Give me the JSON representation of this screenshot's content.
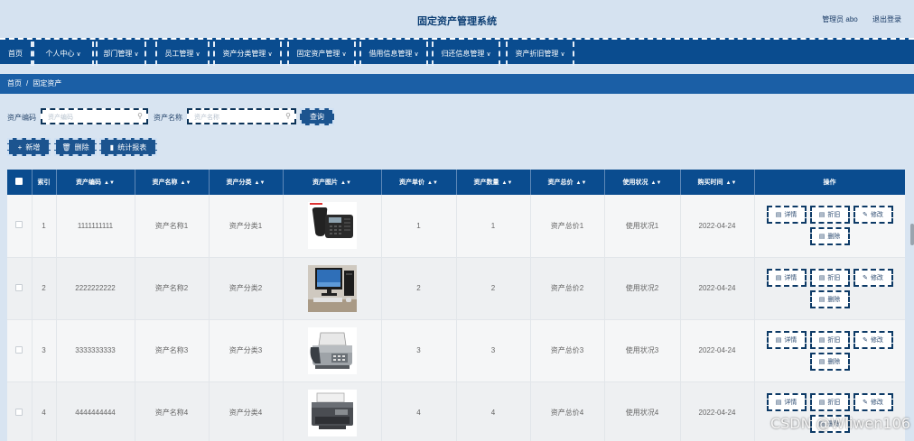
{
  "header": {
    "title": "固定资产管理系统",
    "user_label": "管理员 abo",
    "logout_label": "退出登录"
  },
  "nav": {
    "items": [
      {
        "label": "首页",
        "has_menu": false
      },
      {
        "label": "个人中心",
        "has_menu": true
      },
      {
        "label": "部门管理",
        "has_menu": true
      },
      {
        "label": "员工管理",
        "has_menu": true
      },
      {
        "label": "资产分类管理",
        "has_menu": true
      },
      {
        "label": "固定资产管理",
        "has_menu": true
      },
      {
        "label": "借用信息管理",
        "has_menu": true
      },
      {
        "label": "归还信息管理",
        "has_menu": true
      },
      {
        "label": "资产折旧管理",
        "has_menu": true
      }
    ],
    "chevron": "∨"
  },
  "breadcrumb": {
    "home": "首页",
    "separator": "/",
    "current": "固定资产"
  },
  "search": {
    "code_label": "资产编码",
    "code_placeholder": "资产编码",
    "name_label": "资产名称",
    "name_placeholder": "资产名称",
    "query_button": "查询"
  },
  "toolbar": {
    "add_label": "新增",
    "delete_label": "删除",
    "report_label": "统计报表"
  },
  "table": {
    "headers": [
      "索引",
      "资产编码",
      "资产名称",
      "资产分类",
      "资产图片",
      "资产单价",
      "资产数量",
      "资产总价",
      "使用状况",
      "购买时间",
      "操作"
    ],
    "rows": [
      {
        "index": "1",
        "code": "1111111111",
        "name": "资产名称1",
        "category": "资产分类1",
        "image": "desk-phone",
        "price": "1",
        "qty": "1",
        "total": "资产总价1",
        "status": "使用状况1",
        "date": "2022-04-24"
      },
      {
        "index": "2",
        "code": "2222222222",
        "name": "资产名称2",
        "category": "资产分类2",
        "image": "desktop-computer",
        "price": "2",
        "qty": "2",
        "total": "资产总价2",
        "status": "使用状况2",
        "date": "2022-04-24"
      },
      {
        "index": "3",
        "code": "3333333333",
        "name": "资产名称3",
        "category": "资产分类3",
        "image": "fax-machine",
        "price": "3",
        "qty": "3",
        "total": "资产总价3",
        "status": "使用状况3",
        "date": "2022-04-24"
      },
      {
        "index": "4",
        "code": "4444444444",
        "name": "资产名称4",
        "category": "资产分类4",
        "image": "printer",
        "price": "4",
        "qty": "4",
        "total": "资产总价4",
        "status": "使用状况4",
        "date": "2022-04-24"
      }
    ],
    "actions": {
      "detail": "详情",
      "depreciation": "折旧",
      "edit": "修改",
      "delete": "删除"
    }
  },
  "watermark": "CSDN @Wliwen106",
  "colors": {
    "nav_bg": "#0a4c8f",
    "breadcrumb_bg": "#1b5fa6",
    "page_bg": "#d8e4f1",
    "title": "#0b3d73"
  }
}
